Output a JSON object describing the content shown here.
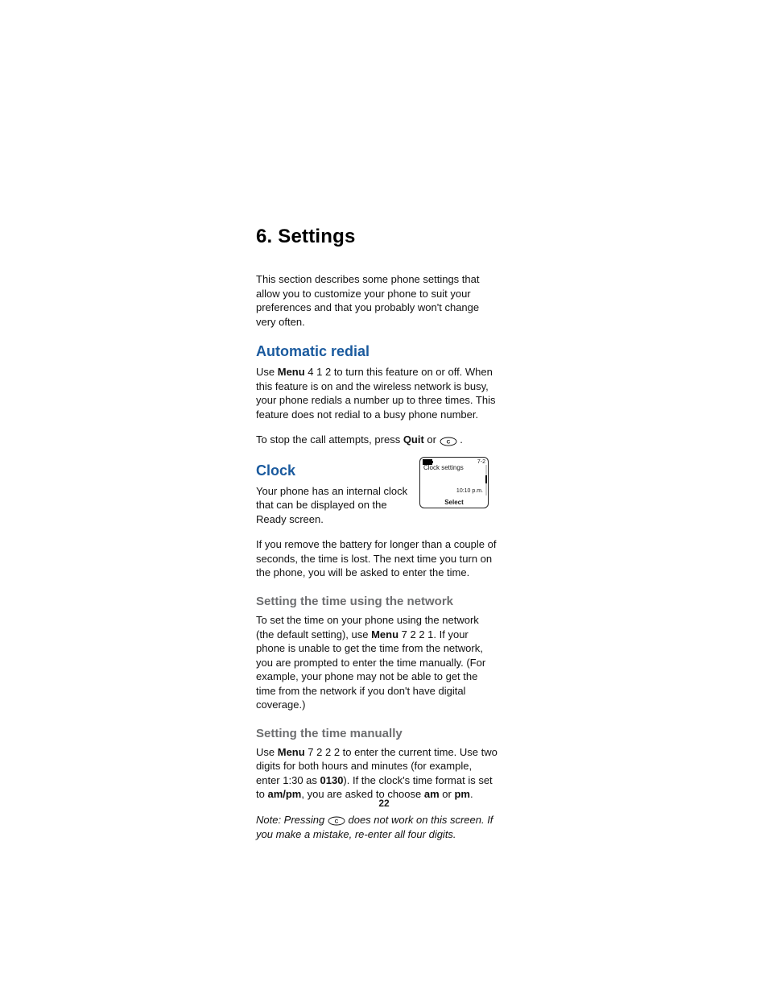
{
  "chapter": {
    "title": "6. Settings"
  },
  "intro": "This section describes some phone settings that allow you to customize your phone to suit your preferences and that you probably won't change very often.",
  "redial": {
    "heading": "Automatic redial",
    "p1_pre": "Use ",
    "p1_menu": "Menu",
    "p1_post": " 4 1 2 to turn this feature on or off. When this feature is on and the wireless network is busy, your phone redials a number up to three times. This feature does not redial to a busy phone number.",
    "p2_pre": "To stop the call attempts, press ",
    "p2_quit": "Quit",
    "p2_or": " or ",
    "p2_post": " ."
  },
  "clock": {
    "heading": "Clock",
    "p1": "Your phone has an internal clock that can be displayed on the Ready screen.",
    "p2": "If you remove the battery for longer than a couple of seconds, the time is lost. The next time you turn on the phone, you will be asked to enter the time."
  },
  "phone_screen": {
    "menu_num": "7-2",
    "title": "Clock settings",
    "time": "10:10 p.m.",
    "softkey": "Select"
  },
  "set_network": {
    "heading": "Setting the time using the network",
    "p1_pre": "To set the time on your phone using the network (the default setting), use ",
    "p1_menu": "Menu",
    "p1_post": " 7 2 2 1. If your phone is unable to get the time from the network, you are prompted to enter the time manually. (For example, your phone may not be able to get the time from the network if you don't have digital coverage.)"
  },
  "set_manual": {
    "heading": "Setting the time manually",
    "p1_pre": "Use ",
    "p1_menu": "Menu",
    "p1_mid1": " 7 2 2 2 to enter the current time. Use two digits for both hours and minutes (for example, enter 1:30 as ",
    "p1_0130": "0130",
    "p1_mid2": "). If the clock's time format is set to ",
    "p1_ampm": "am/pm",
    "p1_mid3": ", you are asked to choose ",
    "p1_am": "am",
    "p1_or": " or ",
    "p1_pm": "pm",
    "p1_end": ".",
    "note_pre": "Note:  Pressing ",
    "note_post": " does not work on this screen. If you make a mistake, re-enter all four digits."
  },
  "page_number": "22"
}
